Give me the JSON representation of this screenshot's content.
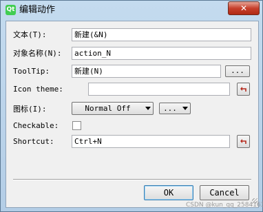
{
  "window": {
    "title": "编辑动作",
    "app_icon_text": "Qt",
    "close_label": "✕"
  },
  "form": {
    "text": {
      "label": "文本(T):",
      "value": "新建(&N)"
    },
    "object_name": {
      "label": "对象名称(N):",
      "value": "action_N"
    },
    "tooltip": {
      "label": "ToolTip:",
      "value": "新建(N)",
      "more_button": "..."
    },
    "icon_theme": {
      "label": "Icon theme:",
      "value": ""
    },
    "icon": {
      "label": "图标(I):",
      "mode": "Normal Off",
      "more_button": "..."
    },
    "checkable": {
      "label": "Checkable:",
      "checked": false
    },
    "shortcut": {
      "label": "Shortcut:",
      "value": "Ctrl+N"
    }
  },
  "buttons": {
    "ok": "OK",
    "cancel": "Cancel"
  },
  "watermark": "CSDN @kun_qq_2584163"
}
